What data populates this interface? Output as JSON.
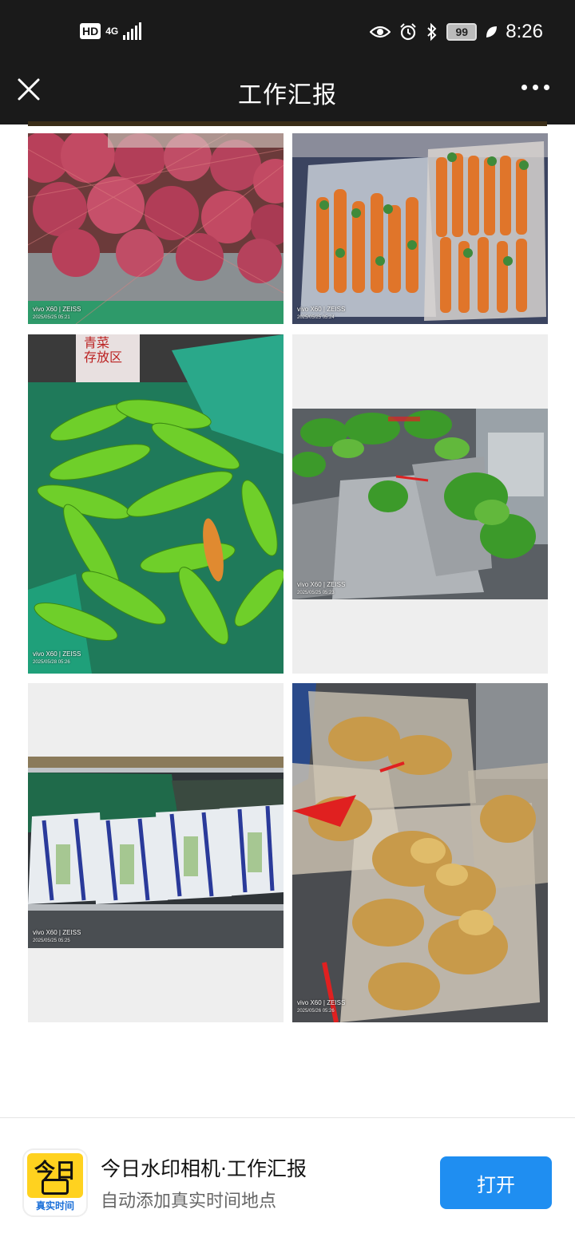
{
  "status_bar": {
    "hd": "HD",
    "network": "4G",
    "battery": "99",
    "time": "8:26"
  },
  "nav": {
    "title": "工作汇报"
  },
  "photos": [
    {
      "subject": "red onions in mesh bags",
      "camera": "vivo X60 | ZEISS",
      "timestamp": "2025/05/25 05:21"
    },
    {
      "subject": "carrots in plastic bags",
      "camera": "vivo X60 | ZEISS",
      "timestamp": "2025/05/25 05:24"
    },
    {
      "subject": "green chili peppers",
      "camera": "vivo X60 | ZEISS",
      "timestamp": "2025/05/28 05:26",
      "sign_text": "青菜\n存放区"
    },
    {
      "subject": "leafy greens in bags",
      "camera": "vivo X60 | ZEISS",
      "timestamp": "2025/05/25 05:23"
    },
    {
      "subject": "bagged vegetables on shelf",
      "camera": "vivo X60 | ZEISS",
      "timestamp": "2025/05/25 05:25"
    },
    {
      "subject": "ginger in plastic bags",
      "camera": "vivo X60 | ZEISS",
      "timestamp": "2025/05/26 05:26"
    }
  ],
  "banner": {
    "logo_text": "今日",
    "logo_subtext": "真实时间",
    "title": "今日水印相机·工作汇报",
    "subtitle": "自动添加真实时间地点",
    "open_label": "打开"
  },
  "colors": {
    "bar_bg": "#1a1a1a",
    "accent": "#1f8ef1",
    "logo_yellow": "#ffd21f"
  }
}
